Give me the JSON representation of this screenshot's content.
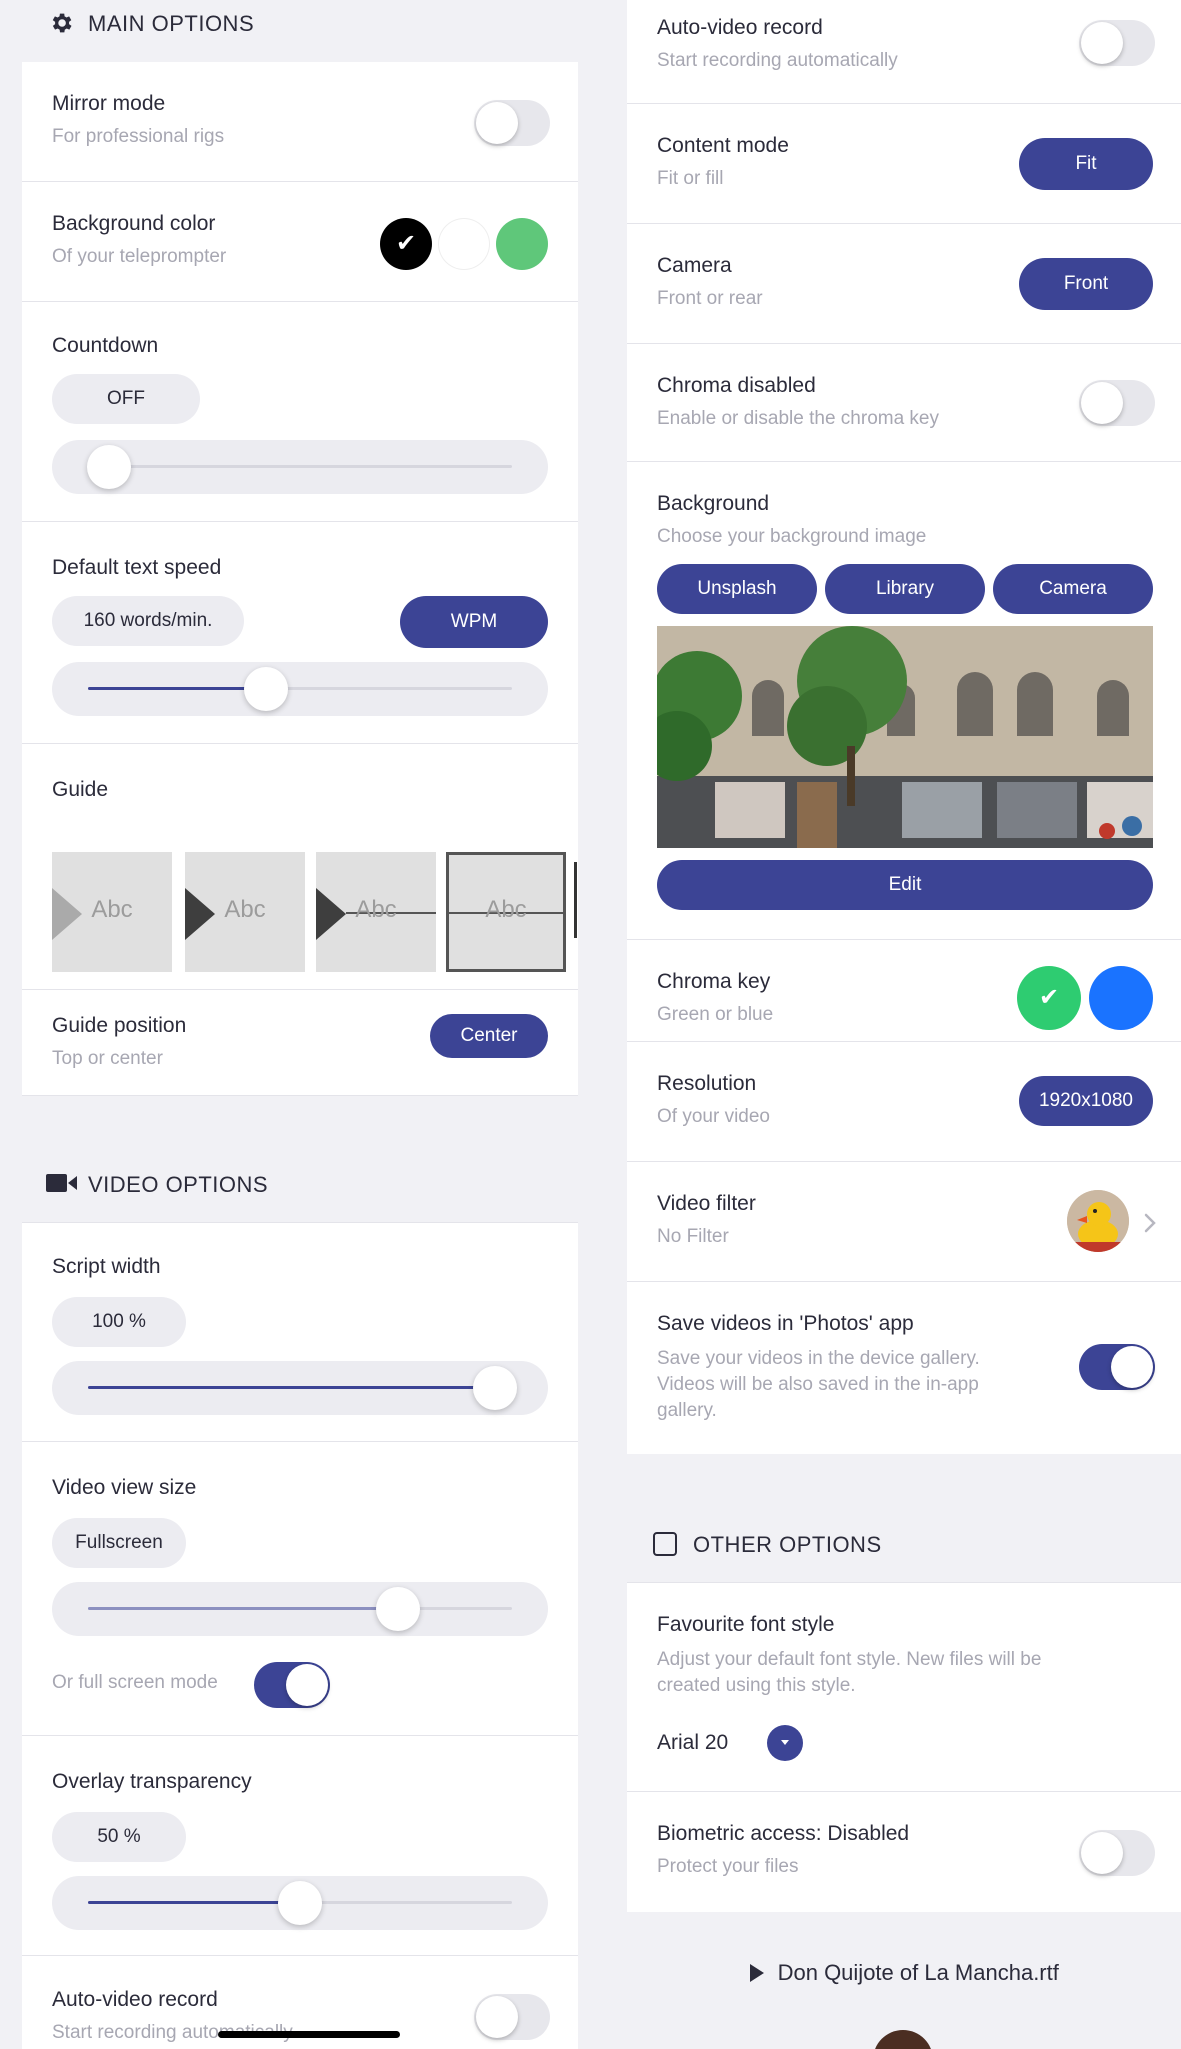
{
  "left": {
    "main_header": "MAIN OPTIONS",
    "mirror": {
      "title": "Mirror mode",
      "subtitle": "For professional rigs",
      "on": false
    },
    "background_color": {
      "title": "Background color",
      "subtitle": "Of your teleprompter",
      "check": "✔",
      "colors": [
        "#000000",
        "#ffffff",
        "#5fc77a"
      ]
    },
    "countdown": {
      "title": "Countdown",
      "value": "OFF",
      "slider": 0.05
    },
    "text_speed": {
      "title": "Default text speed",
      "value": "160 words/min.",
      "unit_button": "WPM",
      "slider": 0.42
    },
    "guide": {
      "title": "Guide",
      "sample": "Abc"
    },
    "guide_position": {
      "title": "Guide position",
      "subtitle": "Top or center",
      "button": "Center"
    },
    "video_header": "VIDEO OPTIONS",
    "script_width": {
      "title": "Script width",
      "value": "100 %",
      "slider": 0.96
    },
    "video_view_size": {
      "title": "Video view size",
      "value": "Fullscreen",
      "slider": 0.73,
      "fullscreen_label": "Or full screen mode",
      "fullscreen_on": true
    },
    "overlay": {
      "title": "Overlay transparency",
      "value": "50 %",
      "slider": 0.5
    },
    "auto_video": {
      "title": "Auto-video record",
      "subtitle": "Start recording automatically",
      "on": false
    }
  },
  "right": {
    "auto_video": {
      "title": "Auto-video record",
      "subtitle": "Start recording automatically",
      "on": false
    },
    "content_mode": {
      "title": "Content mode",
      "subtitle": "Fit or fill",
      "button": "Fit"
    },
    "camera": {
      "title": "Camera",
      "subtitle": "Front or rear",
      "button": "Front"
    },
    "chroma_disabled": {
      "title": "Chroma disabled",
      "subtitle": "Enable or disable the chroma key",
      "on": false
    },
    "background": {
      "title": "Background",
      "subtitle": "Choose your background image",
      "buttons": [
        "Unsplash",
        "Library",
        "Camera"
      ],
      "edit": "Edit"
    },
    "chroma_key": {
      "title": "Chroma key",
      "subtitle": "Green or blue",
      "check": "✔",
      "colors": [
        "#2ecc71",
        "#1a73ff"
      ]
    },
    "resolution": {
      "title": "Resolution",
      "subtitle": "Of your video",
      "button": "1920x1080"
    },
    "video_filter": {
      "title": "Video filter",
      "subtitle": "No Filter"
    },
    "save_photos": {
      "title": "Save videos in 'Photos' app",
      "subtitle_1": "Save your videos in the device gallery.",
      "subtitle_2": "Videos will be also saved in the in-app",
      "subtitle_3": "gallery.",
      "on": true
    },
    "other_header": "OTHER OPTIONS",
    "font_style": {
      "title": "Favourite font style",
      "subtitle_1": "Adjust your default font style. New files will be",
      "subtitle_2": "created using this style.",
      "value": "Arial 20"
    },
    "biometric": {
      "title": "Biometric access: Disabled",
      "subtitle": "Protect your files",
      "on": false
    },
    "file": {
      "name": "Don Quijote of La Mancha.rtf"
    }
  },
  "colors": {
    "accent": "#3c4495",
    "background": "#f1f1f5"
  },
  "icons": {
    "gear": "gear-icon",
    "video": "video-camera-icon",
    "checkbox": "checkbox-icon",
    "play": "play-icon",
    "chevron": "chevron-right-icon",
    "dropdown": "chevron-down-icon"
  }
}
